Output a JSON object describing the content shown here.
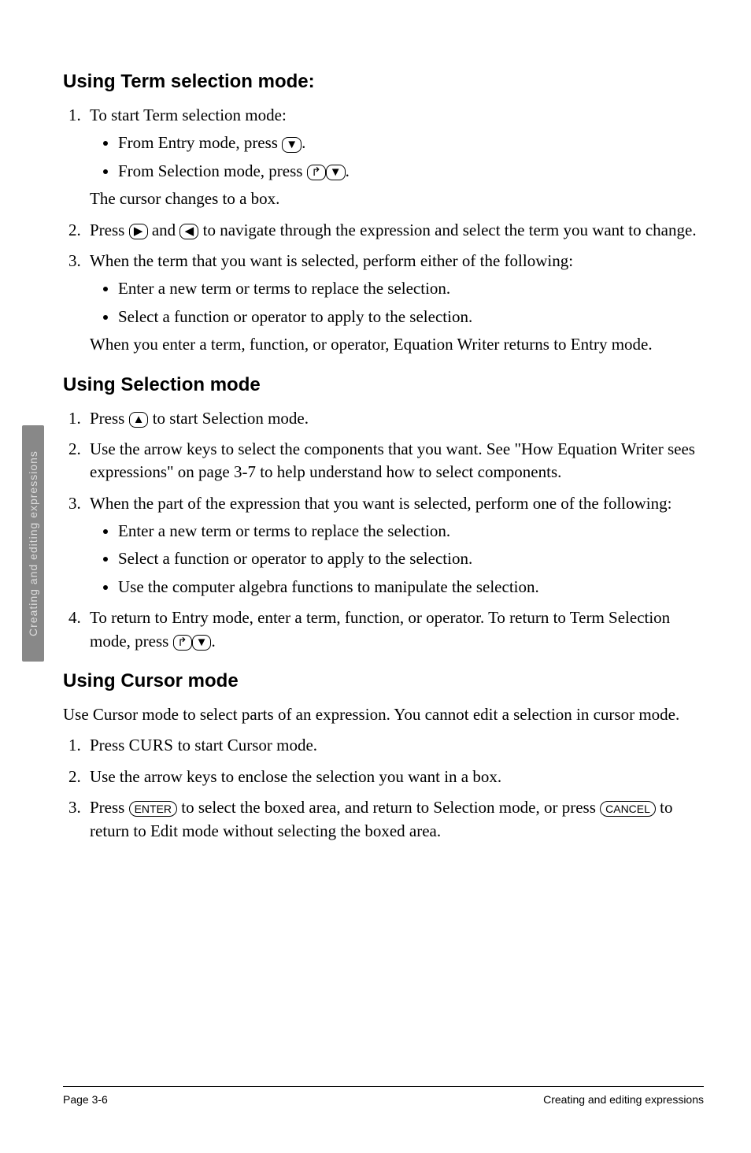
{
  "sideTab": "Creating and editing expressions",
  "section1": {
    "heading": "Using Term selection mode:",
    "item1_lead": "To start Term selection mode:",
    "item1_b1a": "From Entry mode, press ",
    "item1_b1b": ".",
    "item1_b2a": "From Selection mode, press ",
    "item1_b2b": ".",
    "item1_trail": "The cursor changes to a box.",
    "item2a": "Press ",
    "item2b": " and ",
    "item2c": " to navigate through the expression and select the term you want to change.",
    "item3_lead": "When the term that you want is selected, perform either of the following:",
    "item3_b1": "Enter a new term or terms to replace the selection.",
    "item3_b2": "Select a function or operator to apply to the selection.",
    "item3_trail": "When you enter a term, function, or operator, Equation Writer returns to Entry mode."
  },
  "section2": {
    "heading": "Using Selection mode",
    "item1a": "Press ",
    "item1b": " to start Selection mode.",
    "item2": "Use the arrow keys to select the components that you want. See \"How Equation Writer sees expressions\" on page 3-7 to help understand how to select components.",
    "item3_lead": "When the part of the expression that you want is selected, perform one of the following:",
    "item3_b1": "Enter a new term or terms to replace the selection.",
    "item3_b2": "Select a function or operator to apply to the selection.",
    "item3_b3": "Use the computer algebra functions to manipulate the selection.",
    "item4a": "To return to Entry mode, enter a term, function, or operator. To return to Term Selection mode, press ",
    "item4b": "."
  },
  "section3": {
    "heading": "Using Cursor mode",
    "intro": "Use Cursor mode to select parts of an expression. You cannot edit a selection in cursor mode.",
    "item1a": "Press ",
    "item1_curs": "CURS",
    "item1b": " to start Cursor mode.",
    "item2": "Use the arrow keys to enclose the selection you want in a box.",
    "item3a": "Press ",
    "item3b": " to select the boxed area, and return to Selection mode, or press ",
    "item3c": " to return to Edit mode without selecting the boxed area."
  },
  "keys": {
    "down": "▼",
    "right": "▶",
    "left": "◀",
    "up": "▲",
    "shift": "↱",
    "enter": "ENTER",
    "cancel": "CANCEL"
  },
  "footer": {
    "left": "Page 3-6",
    "right": "Creating and editing expressions"
  }
}
